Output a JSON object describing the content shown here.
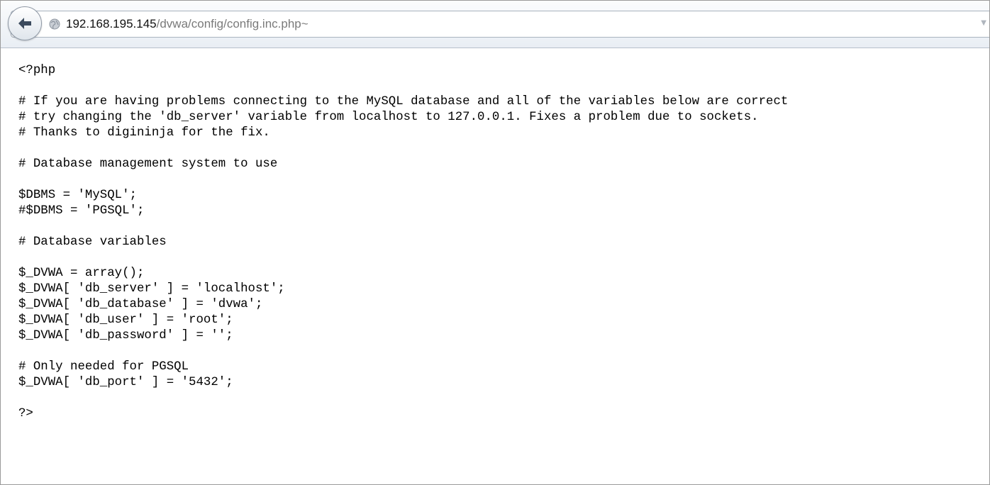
{
  "browser": {
    "url_host": "192.168.195.145",
    "url_path": "/dvwa/config/config.inc.php~",
    "icons": {
      "back": "back-arrow-icon",
      "site": "globe-icon",
      "dropdown": "chevron-down-icon"
    }
  },
  "file": {
    "lines": [
      "<?php",
      "",
      "# If you are having problems connecting to the MySQL database and all of the variables below are correct",
      "# try changing the 'db_server' variable from localhost to 127.0.0.1. Fixes a problem due to sockets.",
      "# Thanks to digininja for the fix.",
      "",
      "# Database management system to use",
      "",
      "$DBMS = 'MySQL';",
      "#$DBMS = 'PGSQL';",
      "",
      "# Database variables",
      "",
      "$_DVWA = array();",
      "$_DVWA[ 'db_server' ] = 'localhost';",
      "$_DVWA[ 'db_database' ] = 'dvwa';",
      "$_DVWA[ 'db_user' ] = 'root';",
      "$_DVWA[ 'db_password' ] = '';",
      "",
      "# Only needed for PGSQL",
      "$_DVWA[ 'db_port' ] = '5432';",
      "",
      "?>"
    ]
  }
}
